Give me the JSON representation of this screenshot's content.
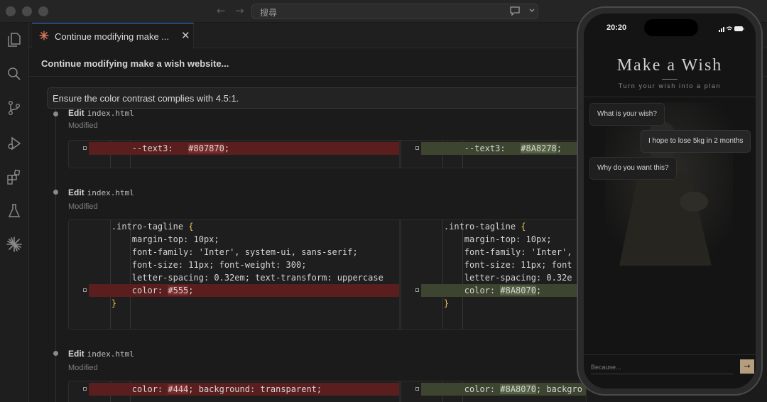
{
  "window": {
    "search_placeholder": "搜尋",
    "nav_back_icon": "←",
    "nav_forward_icon": "→"
  },
  "activity_bar": {
    "icons": [
      "files-icon",
      "search-icon",
      "source-control-icon",
      "run-debug-icon",
      "extensions-icon",
      "flask-icon",
      "claude-icon"
    ]
  },
  "tab": {
    "label": "Continue modifying make ...",
    "close": "✕"
  },
  "chat": {
    "title": "Continue modifying make a wish website...",
    "prompt": "Ensure the color contrast complies with 4.5:1."
  },
  "edits": [
    {
      "label": "Edit",
      "file": "index.html",
      "status": "Modified",
      "left": [
        {
          "code": "        --text3:   ",
          "hl": "#807870",
          "tail": ";",
          "type": "del",
          "marker": true
        }
      ],
      "right": [
        {
          "code": "        --text3:   ",
          "hl": "#8A8278",
          "tail": ";",
          "type": "add",
          "marker": true
        }
      ]
    },
    {
      "label": "Edit",
      "file": "index.html",
      "status": "Modified",
      "left": [
        {
          "code": "    .intro-tagline ",
          "brace": "{",
          "type": "ctx"
        },
        {
          "code": "        margin-top: 10px;",
          "type": "ctx"
        },
        {
          "code": "        font-family: 'Inter', system-ui, sans-serif;",
          "type": "ctx"
        },
        {
          "code": "        font-size: 11px; font-weight: 300;",
          "type": "ctx"
        },
        {
          "code": "        letter-spacing: 0.32em; text-transform: uppercase",
          "type": "ctx"
        },
        {
          "code": "        color: ",
          "hl": "#555",
          "tail": ";",
          "type": "del",
          "marker": true
        },
        {
          "code": "    ",
          "brace": "}",
          "type": "ctx"
        }
      ],
      "right": [
        {
          "code": "    .intro-tagline ",
          "brace": "{",
          "type": "ctx"
        },
        {
          "code": "        margin-top: 10px;",
          "type": "ctx"
        },
        {
          "code": "        font-family: 'Inter',",
          "type": "ctx"
        },
        {
          "code": "        font-size: 11px; font",
          "type": "ctx"
        },
        {
          "code": "        letter-spacing: 0.32e",
          "type": "ctx"
        },
        {
          "code": "        color: ",
          "hl": "#8A8070",
          "tail": ";",
          "type": "add",
          "marker": true
        },
        {
          "code": "    ",
          "brace": "}",
          "type": "ctx"
        }
      ]
    },
    {
      "label": "Edit",
      "file": "index.html",
      "status": "Modified",
      "left": [
        {
          "code": "        color: ",
          "hl": "#444",
          "tail": "; background: transparent;",
          "type": "del",
          "marker": true
        }
      ],
      "right": [
        {
          "code": "        color: ",
          "hl": "#8A8070",
          "tail": "; backgro",
          "type": "add",
          "marker": true
        }
      ]
    }
  ],
  "phone": {
    "time": "20:20",
    "app_title": "Make a Wish",
    "tagline": "Turn your wish into a plan",
    "messages": [
      {
        "from": "bot",
        "text": "What is your wish?"
      },
      {
        "from": "user",
        "text": "I hope to lose 5kg in 2 months"
      },
      {
        "from": "bot",
        "text": "Why do you want this?"
      }
    ],
    "input_placeholder": "Because...",
    "send_icon": "→"
  },
  "colors": {
    "accent_tab": "#3c8ce7",
    "diff_removed": "#5a1e1e",
    "diff_added": "#3d4530",
    "send_button": "#b59e7e"
  }
}
